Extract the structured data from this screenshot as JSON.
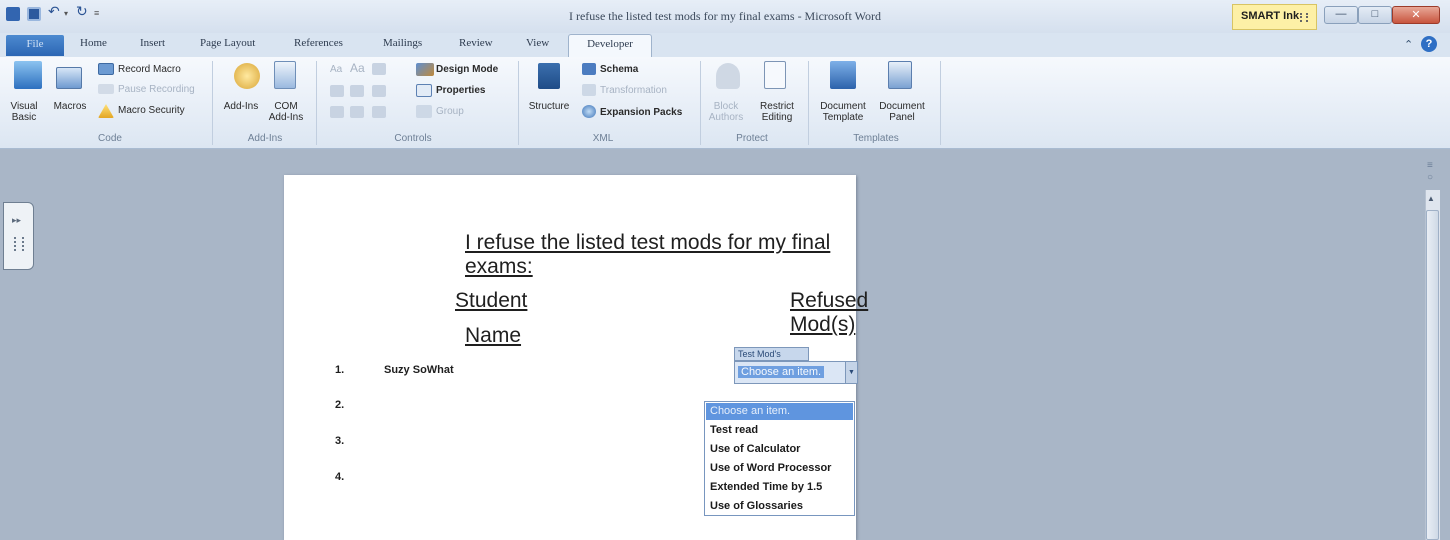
{
  "window": {
    "title": "I refuse the listed test mods for my final exams - Microsoft Word",
    "smart_ink": "SMART Ink"
  },
  "tabs": [
    "File",
    "Home",
    "Insert",
    "Page Layout",
    "References",
    "Mailings",
    "Review",
    "View",
    "Developer"
  ],
  "active_tab": "Developer",
  "ribbon": {
    "code": {
      "label": "Code",
      "visual_basic": [
        "Visual",
        "Basic"
      ],
      "macros": "Macros",
      "record_macro": "Record Macro",
      "pause_recording": "Pause Recording",
      "macro_security": "Macro Security"
    },
    "addins": {
      "label": "Add-Ins",
      "addins": "Add-Ins",
      "com_addins": [
        "COM",
        "Add-Ins"
      ]
    },
    "controls": {
      "label": "Controls",
      "design_mode": "Design Mode",
      "properties": "Properties",
      "group": "Group",
      "aa_large": "Aa",
      "aa_small": "Aa"
    },
    "xml": {
      "label": "XML",
      "structure": "Structure",
      "schema": "Schema",
      "transformation": "Transformation",
      "expansion_packs": "Expansion Packs"
    },
    "protect": {
      "label": "Protect",
      "block_authors": [
        "Block",
        "Authors"
      ],
      "restrict_editing": [
        "Restrict",
        "Editing"
      ]
    },
    "templates": {
      "label": "Templates",
      "document_template": [
        "Document",
        "Template"
      ],
      "document_panel": [
        "Document",
        "Panel"
      ]
    }
  },
  "document": {
    "heading": "I refuse the listed test mods for my final exams:",
    "col_student": [
      "Student",
      "Name"
    ],
    "col_refused": "Refused Mod(s)",
    "rows": [
      {
        "num": "1.",
        "name": "Suzy SoWhat"
      },
      {
        "num": "2.",
        "name": ""
      },
      {
        "num": "3.",
        "name": ""
      },
      {
        "num": "4.",
        "name": ""
      }
    ],
    "content_control": {
      "tag": "Test Mod's",
      "value": "Choose an item.",
      "options": [
        "Choose an item.",
        "Test read",
        "Use of Calculator",
        "Use of Word Processor",
        "Extended Time by 1.5",
        "Use of Glossaries"
      ]
    }
  },
  "colors": {
    "accent": "#2b66b4",
    "highlight": "#5f95df",
    "smart_ink_bg": "#fdf0a6",
    "close_button": "#c8553e"
  }
}
